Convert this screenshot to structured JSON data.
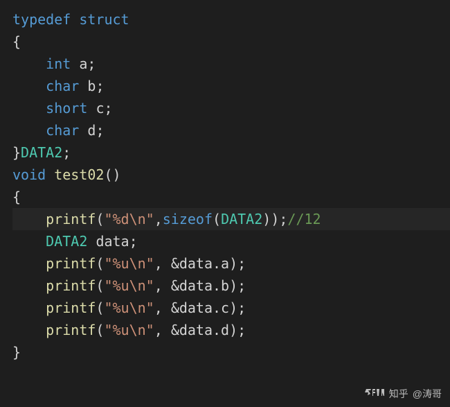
{
  "code": {
    "l1": {
      "typedef": "typedef",
      "struct": "struct"
    },
    "l2": {
      "brace": "{"
    },
    "l3": {
      "type": "int",
      "name": "a",
      "semi": ";"
    },
    "l4": {
      "type": "char",
      "name": "b",
      "semi": ";"
    },
    "l5": {
      "type": "short",
      "name": "c",
      "semi": ";"
    },
    "l6": {
      "type": "char",
      "name": "d",
      "semi": ";"
    },
    "l7": {
      "brace": "}",
      "typename": "DATA2",
      "semi": ";"
    },
    "l8": {
      "void": "void",
      "name": "test02",
      "parens": "()"
    },
    "l9": {
      "brace": "{"
    },
    "l10": {
      "func": "printf",
      "lp": "(",
      "str": "\"%d\\n\"",
      "comma": ",",
      "sizeof": "sizeof",
      "lp2": "(",
      "type": "DATA2",
      "rp2": ")",
      "rp": ")",
      "semi": ";",
      "comment": "//12"
    },
    "l11": {
      "type": "DATA2",
      "name": "data",
      "semi": ";"
    },
    "l12": {
      "func": "printf",
      "lp": "(",
      "str": "\"%u\\n\"",
      "comma_sp": ", ",
      "amp_expr": "&data.a",
      "rp": ")",
      "semi": ";"
    },
    "l13": {
      "func": "printf",
      "lp": "(",
      "str": "\"%u\\n\"",
      "comma_sp": ", ",
      "amp_expr": "&data.b",
      "rp": ")",
      "semi": ";"
    },
    "l14": {
      "func": "printf",
      "lp": "(",
      "str": "\"%u\\n\"",
      "comma_sp": ", ",
      "amp_expr": "&data.c",
      "rp": ")",
      "semi": ";"
    },
    "l15": {
      "func": "printf",
      "lp": "(",
      "str": "\"%u\\n\"",
      "comma_sp": ", ",
      "amp_expr": "&data.d",
      "rp": ")",
      "semi": ";"
    },
    "l16": {
      "brace": "}"
    }
  },
  "watermark": {
    "brand": "知乎",
    "at": "@涛哥"
  },
  "colors": {
    "bg": "#1e1e1e",
    "keyword": "#569cd6",
    "typename": "#4ec9b0",
    "function": "#dcdcaa",
    "string": "#ce9178",
    "comment": "#6a9955",
    "text": "#d4d4d4"
  }
}
